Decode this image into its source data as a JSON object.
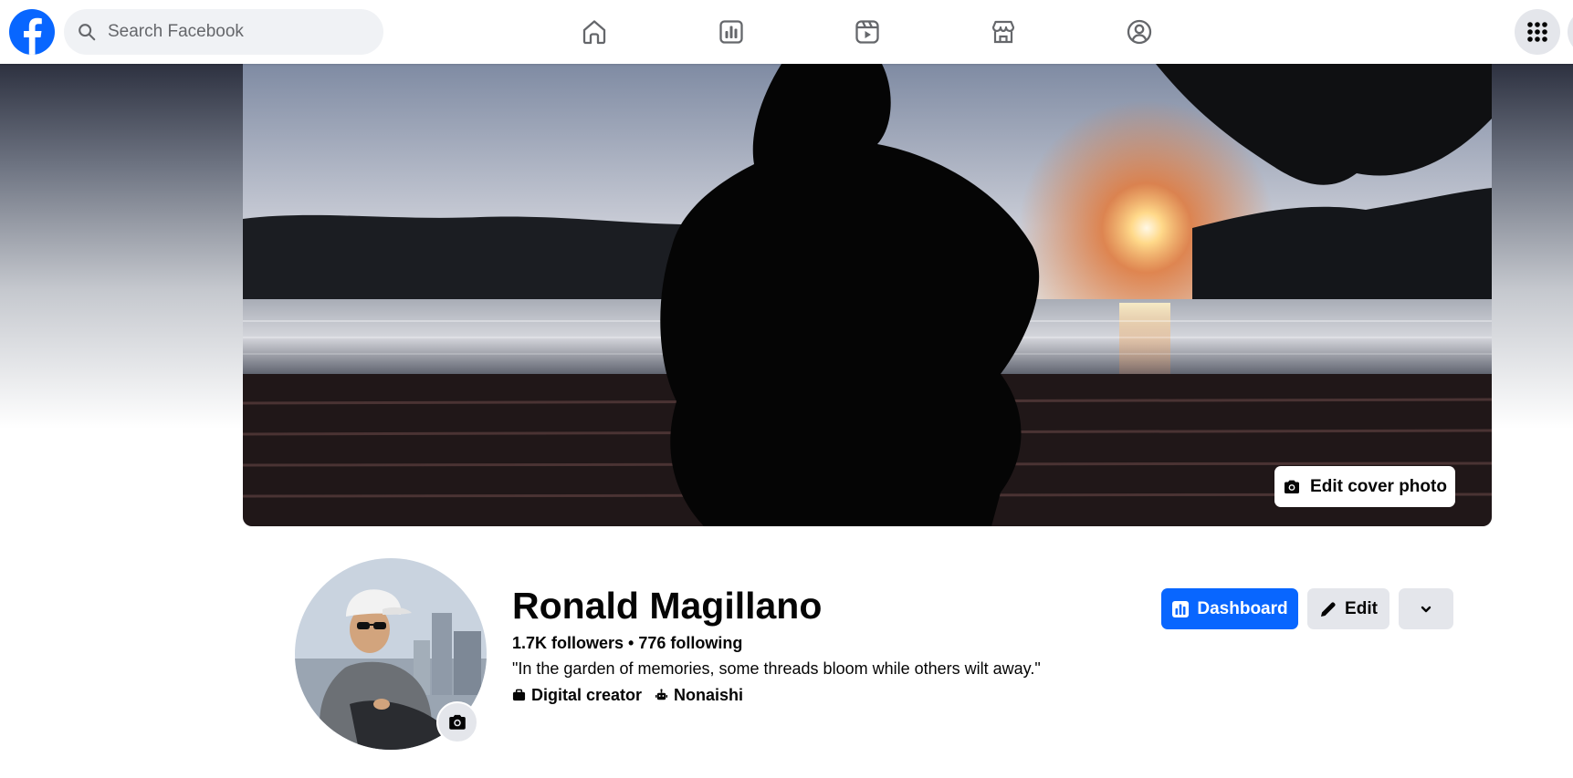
{
  "topbar": {
    "search": {
      "placeholder": "Search Facebook",
      "value": ""
    },
    "nav": [
      "home-icon",
      "dashboard-icon",
      "reels-icon",
      "marketplace-icon",
      "groups-icon"
    ],
    "menu_icon": "grid-menu-icon"
  },
  "profile": {
    "edit_cover_label": "Edit cover photo",
    "name": "Ronald Magillano",
    "followers": "1.7K followers",
    "separator": " • ",
    "following": "776 following",
    "bio": "\"In the garden of memories, some threads bloom while others wilt away.\"",
    "category": "Digital creator",
    "workplace": "Nonaishi"
  },
  "actions": {
    "dashboard_label": "Dashboard",
    "edit_label": "Edit"
  },
  "colors": {
    "brand_blue": "#0866ff",
    "button_gray": "#e4e6eb",
    "search_bg": "#f0f2f5",
    "text_primary": "#050505"
  }
}
